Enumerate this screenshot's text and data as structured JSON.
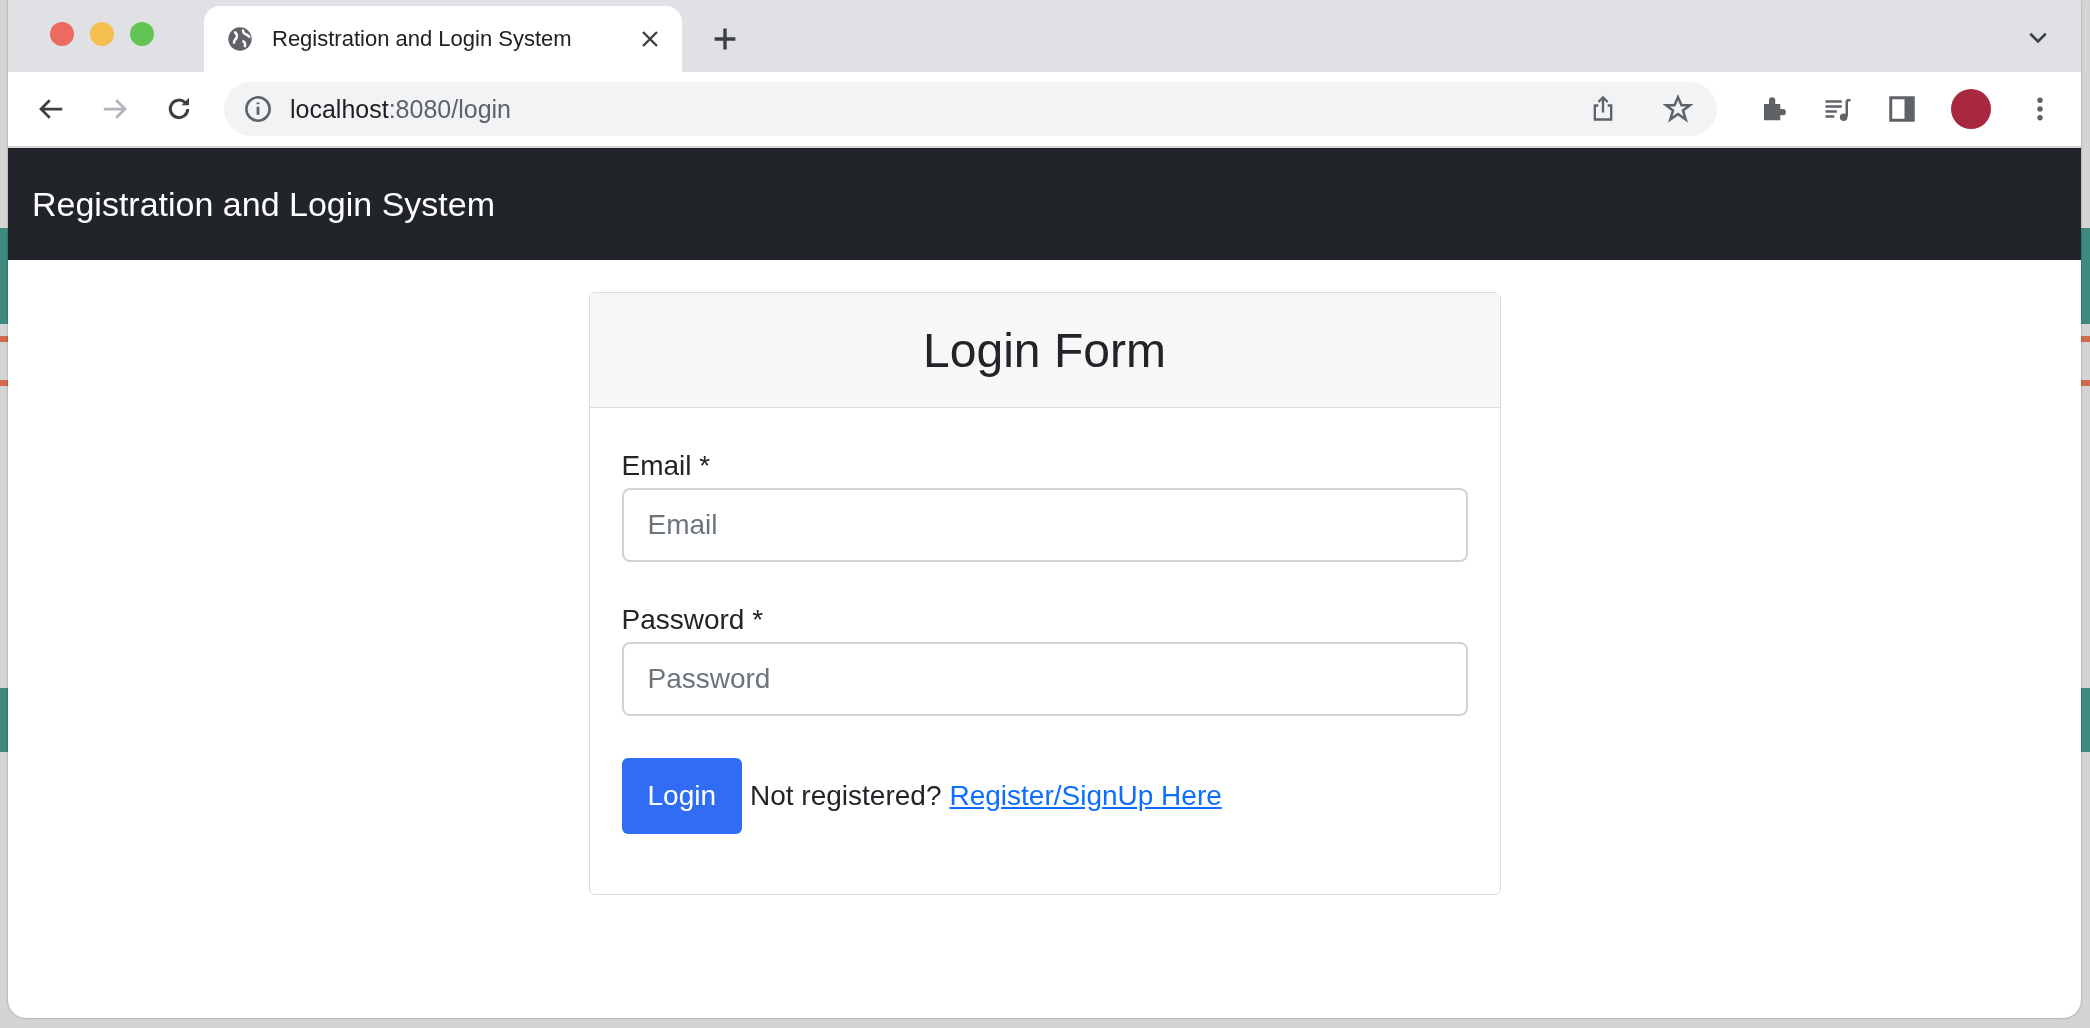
{
  "browser": {
    "tab": {
      "title": "Registration and Login System",
      "selected": true
    },
    "address": {
      "host": "localhost",
      "path": ":8080/login"
    }
  },
  "navbar": {
    "brand": "Registration and Login System"
  },
  "card": {
    "title": "Login Form",
    "fields": [
      {
        "label": "Email *",
        "placeholder": "Email"
      },
      {
        "label": "Password *",
        "placeholder": "Password"
      }
    ],
    "button": "Login",
    "prompt": "Not registered?",
    "link": "Register/SignUp Here"
  }
}
